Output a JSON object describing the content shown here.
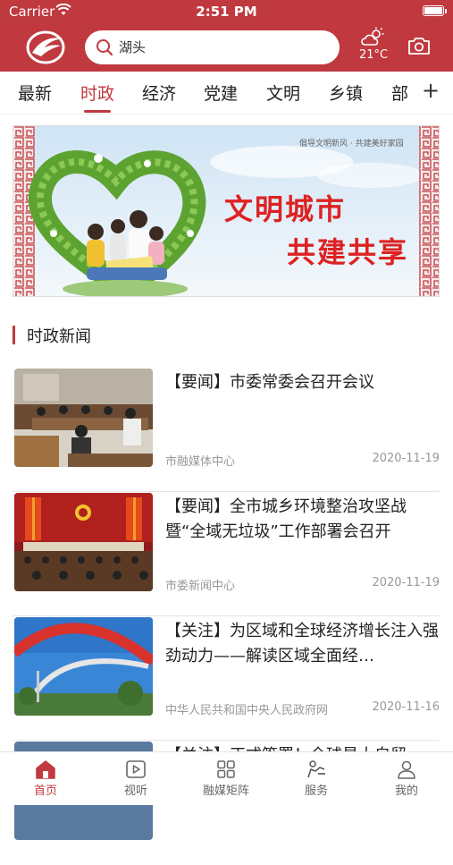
{
  "status": {
    "carrier": "Carrier",
    "time": "2:51 PM"
  },
  "header": {
    "search_text": "湖头",
    "temperature": "21°C"
  },
  "tabs": [
    {
      "label": "最新",
      "active": false
    },
    {
      "label": "时政",
      "active": true
    },
    {
      "label": "经济",
      "active": false
    },
    {
      "label": "党建",
      "active": false
    },
    {
      "label": "文明",
      "active": false
    },
    {
      "label": "乡镇",
      "active": false
    },
    {
      "label": "部",
      "active": false
    }
  ],
  "tab_add": "+",
  "banner": {
    "slogan": "倡导文明新风 · 共建美好家园",
    "line1": "文明城市",
    "line2": "共建共享"
  },
  "section": {
    "title": "时政新闻"
  },
  "news": [
    {
      "title": "【要闻】市委常委会召开会议",
      "source": "市融媒体中心",
      "date": "2020-11-19"
    },
    {
      "title": "【要闻】全市城乡环境整治攻坚战暨“全域无垃圾”工作部署会召开",
      "source": "市委新闻中心",
      "date": "2020-11-19"
    },
    {
      "title": "【关注】为区域和全球经济增长注入强劲动力——解读区域全面经…",
      "source": "中华人民共和国中央人民政府网",
      "date": "2020-11-16"
    },
    {
      "title": "【关注】正式签署！全球最大自贸",
      "source": "",
      "date": ""
    }
  ],
  "bottom_nav": [
    {
      "label": "首页",
      "icon": "home-icon",
      "active": true
    },
    {
      "label": "视听",
      "icon": "play-icon",
      "active": false
    },
    {
      "label": "融媒矩阵",
      "icon": "grid-icon",
      "active": false
    },
    {
      "label": "服务",
      "icon": "service-icon",
      "active": false
    },
    {
      "label": "我的",
      "icon": "user-icon",
      "active": false
    }
  ],
  "colors": {
    "brand": "#c0393f"
  }
}
